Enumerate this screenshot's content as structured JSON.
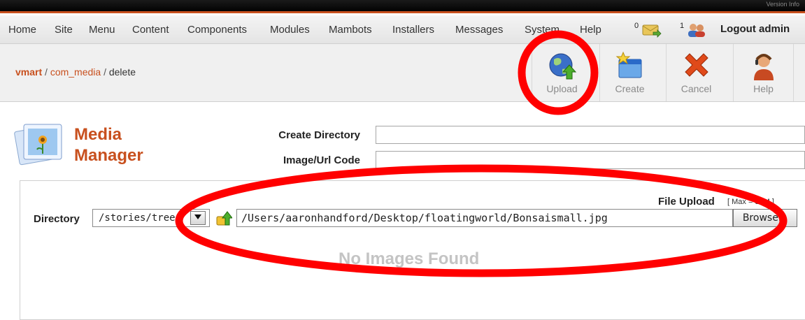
{
  "topbar": {
    "version_text": "Version Info"
  },
  "menu": {
    "items": [
      "Home",
      "Site",
      "Menu",
      "Content",
      "Components",
      "Modules",
      "Mambots",
      "Installers",
      "Messages",
      "System",
      "Help"
    ]
  },
  "status": {
    "messages_count": "0",
    "users_count": "1",
    "logout_label": "Logout admin"
  },
  "breadcrumb": {
    "part1": "vmart",
    "sep": " / ",
    "part2": "com_media",
    "part3": "delete"
  },
  "toolbar": {
    "upload_label": "Upload",
    "create_label": "Create",
    "cancel_label": "Cancel",
    "help_label": "Help"
  },
  "page": {
    "title_line1": "Media",
    "title_line2": "Manager"
  },
  "form": {
    "create_directory_label": "Create Directory",
    "create_directory_value": "",
    "image_url_code_label": "Image/Url Code",
    "image_url_code_value": ""
  },
  "upload": {
    "file_upload_label": "File Upload",
    "max_label": "[ Max = 32M ]",
    "directory_label": "Directory",
    "directory_value": "/stories/trees",
    "file_path": "/Users/aaronhandford/Desktop/floatingworld/Bonsaismall.jpg",
    "browse_label": "Browse..."
  },
  "content": {
    "no_images_text": "No Images Found"
  },
  "colors": {
    "accent": "#c8501e",
    "annotation": "#ff0000"
  }
}
